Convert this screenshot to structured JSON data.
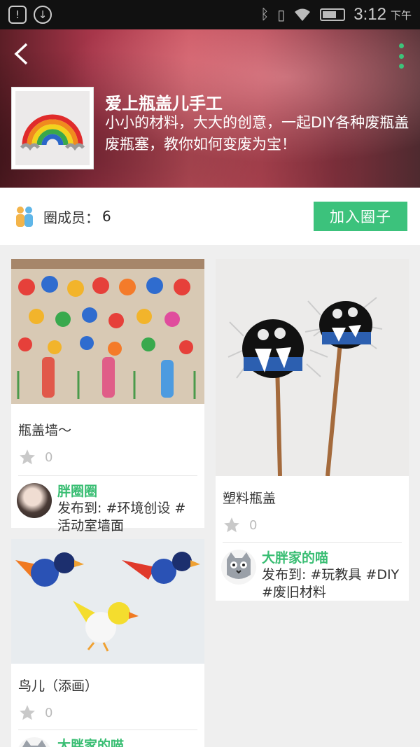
{
  "status_bar": {
    "time": "3:12",
    "ampm": "下午",
    "battery_level": 0.6
  },
  "header": {
    "title": "爱上瓶盖儿手工",
    "description": "小小的材料，大大的创意，一起DIY各种废瓶盖废瓶塞，教你如何变废为宝！",
    "back_icon": "back-arrow-icon",
    "more_icon": "more-vertical-icon"
  },
  "members": {
    "label": "圈成员：",
    "count": "6",
    "join_label": "加入圈子"
  },
  "posts": [
    {
      "title": "瓶盖墙～",
      "likes": "0",
      "author": "胖圈圈",
      "posted_to": "发布到: #环境创设 #活动室墙面"
    },
    {
      "title": "塑料瓶盖",
      "likes": "0",
      "author": "大胖家的喵",
      "posted_to": "发布到: #玩教具 #DIY #废旧材料"
    },
    {
      "title": "鸟儿（添画）",
      "likes": "0",
      "author": "大胖家的喵"
    }
  ],
  "colors": {
    "accent": "#3cc27c",
    "author_green": "#38bd72"
  }
}
